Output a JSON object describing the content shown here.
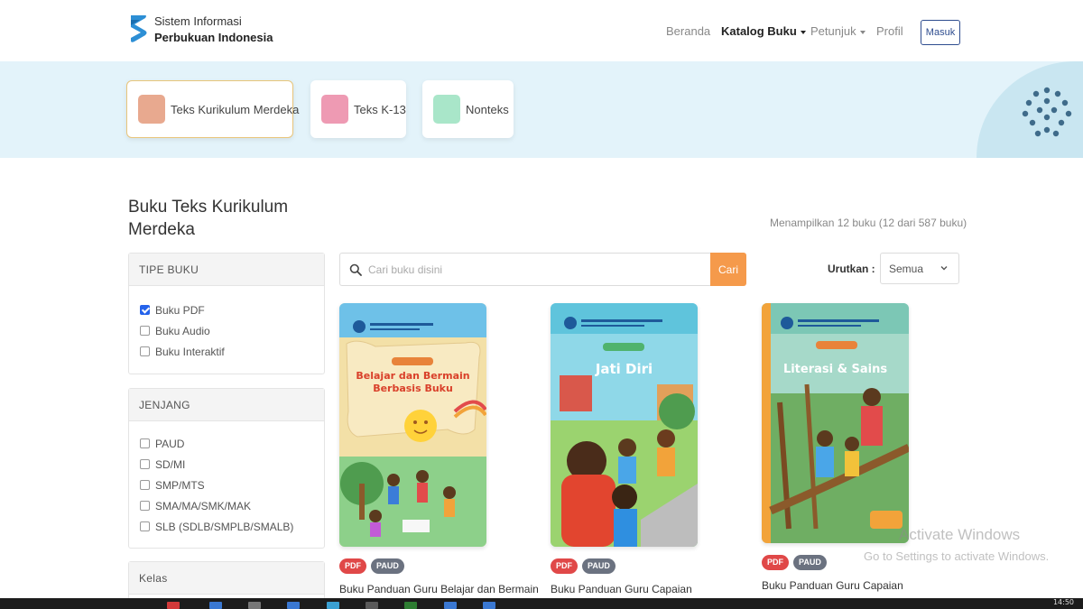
{
  "brand": {
    "line1": "Sistem Informasi",
    "line2": "Perbukuan Indonesia"
  },
  "nav": {
    "items": [
      {
        "label": "Beranda",
        "active": false,
        "dropdown": false
      },
      {
        "label": "Katalog Buku",
        "active": true,
        "dropdown": true
      },
      {
        "label": "Petunjuk",
        "active": false,
        "dropdown": true
      },
      {
        "label": "Profil",
        "active": false,
        "dropdown": false
      }
    ],
    "login_label": "Masuk"
  },
  "categories": [
    {
      "label": "Teks Kurikulum Merdeka",
      "color": "#e8a98f",
      "active": true
    },
    {
      "label": "Teks K-13",
      "color": "#ee9ab3",
      "active": false
    },
    {
      "label": "Nonteks",
      "color": "#a9e6c9",
      "active": false
    }
  ],
  "page": {
    "title": "Buku Teks Kurikulum Merdeka",
    "showing": "Menampilkan 12 buku (12 dari 587 buku)"
  },
  "filters": {
    "tipe_buku": {
      "title": "TIPE BUKU",
      "options": [
        {
          "label": "Buku PDF",
          "checked": true
        },
        {
          "label": "Buku Audio",
          "checked": false
        },
        {
          "label": "Buku Interaktif",
          "checked": false
        }
      ]
    },
    "jenjang": {
      "title": "JENJANG",
      "options": [
        {
          "label": "PAUD",
          "checked": false
        },
        {
          "label": "SD/MI",
          "checked": false
        },
        {
          "label": "SMP/MTS",
          "checked": false
        },
        {
          "label": "SMA/MA/SMK/MAK",
          "checked": false
        },
        {
          "label": "SLB (SDLB/SMPLB/SMALB)",
          "checked": false
        }
      ]
    },
    "kelas": {
      "title": "Kelas"
    }
  },
  "search": {
    "placeholder": "Cari buku disini",
    "value": "",
    "button_label": "Cari"
  },
  "sort": {
    "label": "Urutkan :",
    "value": "Semua"
  },
  "books": [
    {
      "cover_title_1": "Belajar dan Bermain",
      "cover_title_2": "Berbasis Buku",
      "badges": [
        "PDF",
        "PAUD"
      ],
      "title": "Buku Panduan Guru Belajar dan Bermain",
      "cover_color": "#f6e6b5"
    },
    {
      "cover_title_1": "Jati Diri",
      "cover_title_2": "",
      "badges": [
        "PDF",
        "PAUD"
      ],
      "title": "Buku Panduan Guru Capaian",
      "cover_color": "#7dd3e0"
    },
    {
      "cover_title_1": "Literasi & Sains",
      "cover_title_2": "",
      "badges": [
        "PDF",
        "PAUD"
      ],
      "title": "Buku Panduan Guru Capaian",
      "cover_color": "#9fd4c4"
    }
  ],
  "watermark": {
    "line1": "Activate Windows",
    "line2": "Go to Settings to activate Windows."
  },
  "taskbar": {
    "clock": "14:50"
  }
}
